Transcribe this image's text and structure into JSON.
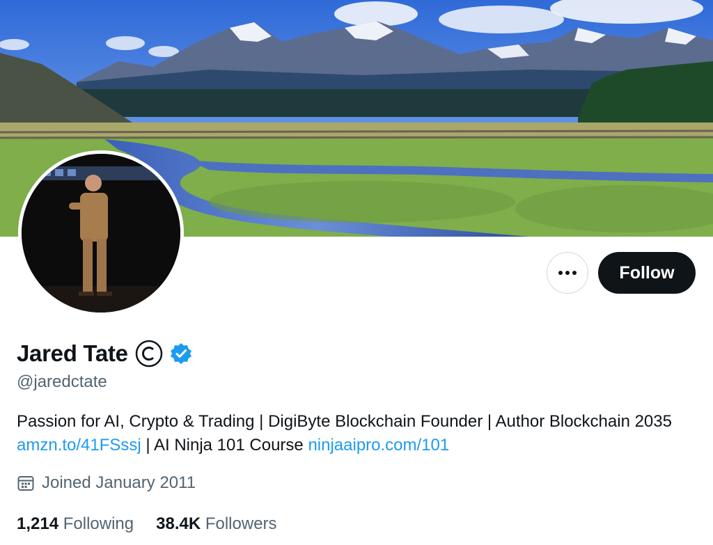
{
  "profile": {
    "display_name": "Jared Tate",
    "handle": "@jaredctate",
    "bio_text_1": "Passion for AI, Crypto & Trading | DigiByte Blockchain Founder | Author Blockchain 2035 ",
    "bio_link_1": "amzn.to/41FSssj",
    "bio_text_2": " | AI Ninja 101 Course ",
    "bio_link_2": "ninjaaipro.com/101",
    "joined": "Joined January 2011"
  },
  "actions": {
    "follow_label": "Follow",
    "more_icon": "more-horizontal-icon"
  },
  "stats": {
    "following_count": "1,214",
    "following_label": "Following",
    "followers_count": "38.4K",
    "followers_label": "Followers"
  },
  "icons": {
    "badge": "copyright-icon",
    "verified": "verified-badge-icon",
    "calendar": "calendar-icon"
  },
  "colors": {
    "accent": "#1d9bf0",
    "text": "#0f1419",
    "muted": "#536471",
    "follow_bg": "#0f1419"
  }
}
